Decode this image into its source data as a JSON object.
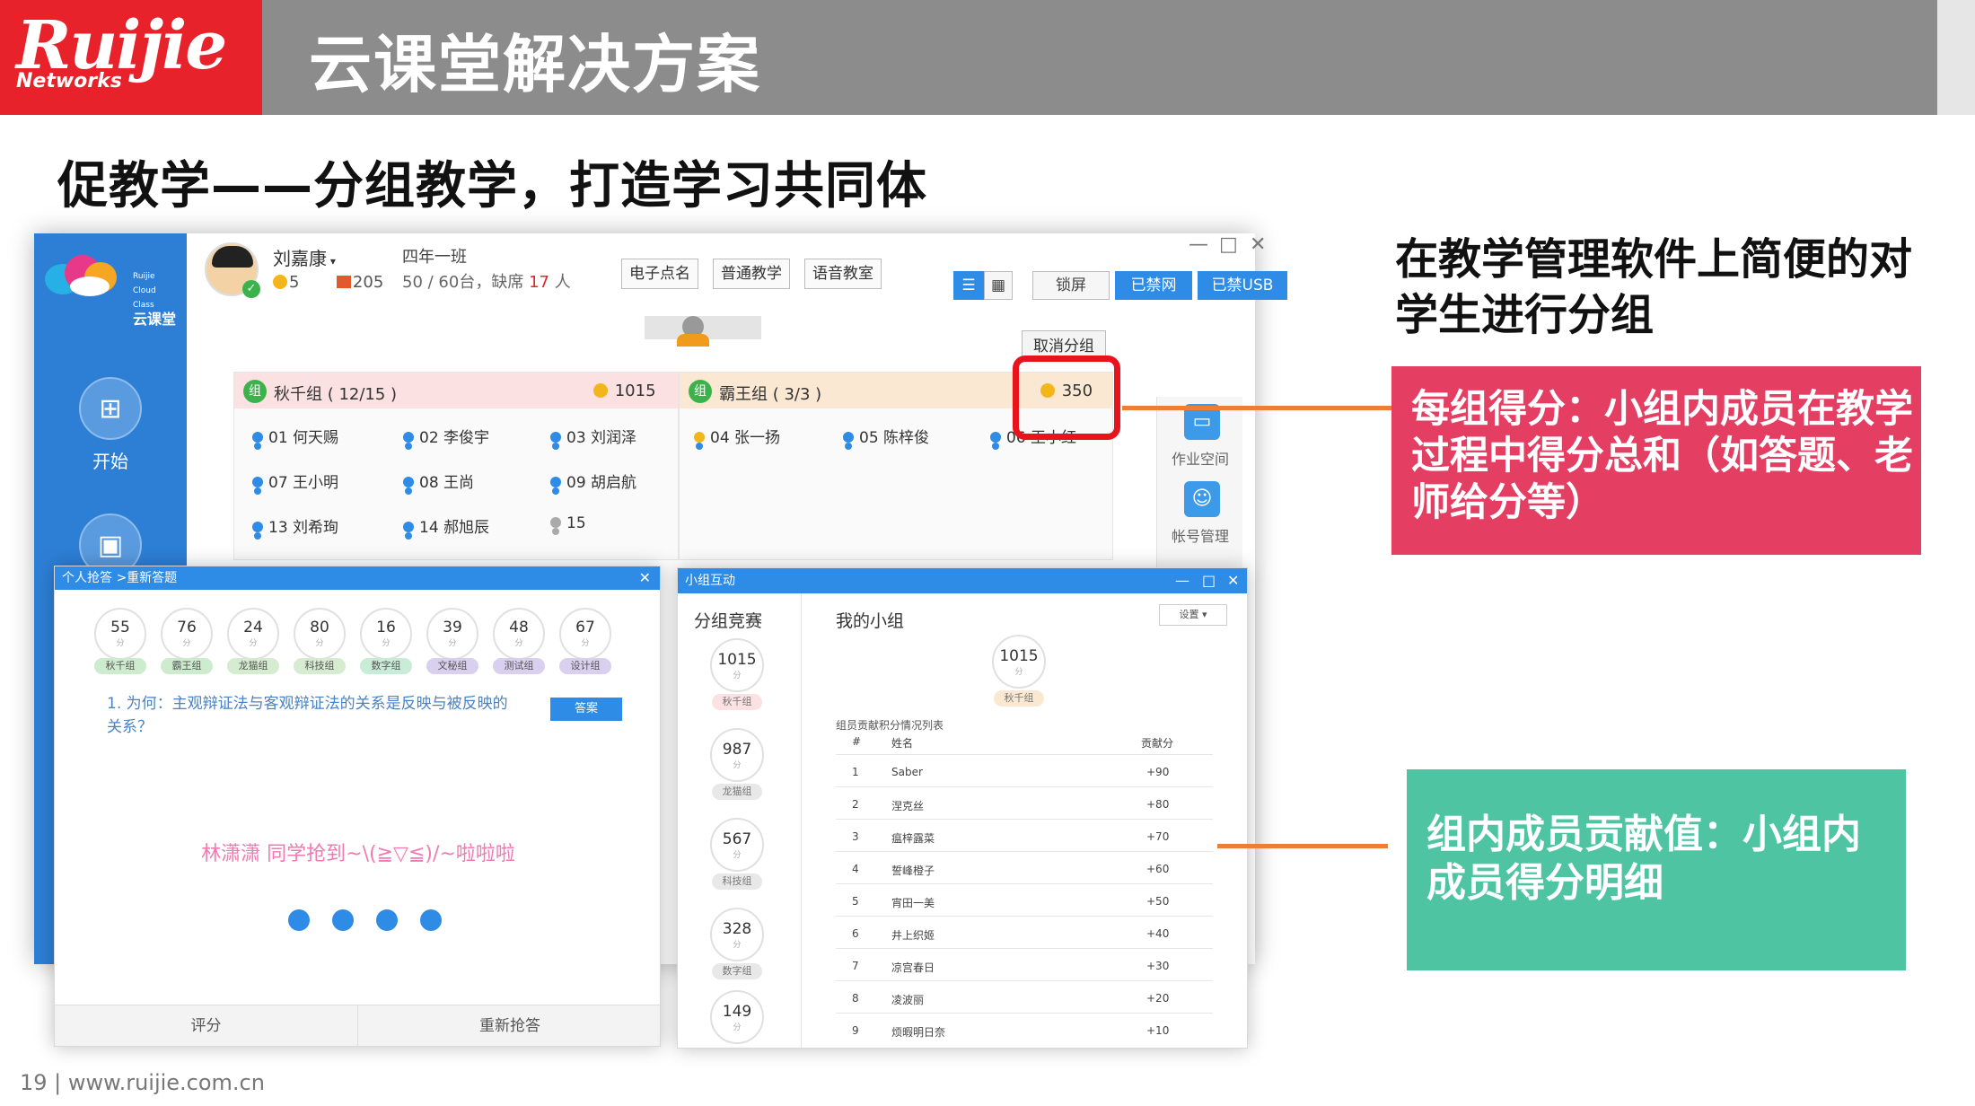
{
  "header": {
    "logo_main": "Ruijie",
    "logo_sub": "Networks",
    "title": "云课堂解决方案"
  },
  "subtitle": "促教学——分组教学，打造学习共同体",
  "app": {
    "sidebar": {
      "brand_line1": "Ruijie",
      "brand_line2": "Cloud Class",
      "brand_line3": "云课堂",
      "items": [
        {
          "label": "开始",
          "icon": "windows-icon"
        },
        {
          "label": "",
          "icon": "monitor-icon"
        }
      ]
    },
    "user": {
      "name": "刘嘉康",
      "coins": "5",
      "gifts": "205"
    },
    "class": {
      "name": "四年一班",
      "stats_prefix": "50 / 60台，缺席",
      "absent": "17",
      "absent_unit": "人"
    },
    "toolbar": {
      "roll_call": "电子点名",
      "normal_teaching": "普通教学",
      "voice_classroom": "语音教室",
      "lock_screen": "锁屏",
      "net_disabled": "已禁网",
      "usb_disabled": "已禁USB",
      "cancel_group": "取消分组"
    },
    "groups": [
      {
        "badge": "组",
        "name": "秋千组 ( 12/15 )",
        "score": "1015",
        "students": [
          "01 何天赐",
          "02 李俊宇",
          "03 刘润泽",
          "07 王小明",
          "08 王尚",
          "09 胡启航",
          "13 刘希珣",
          "14 郝旭辰",
          "15"
        ]
      },
      {
        "badge": "组",
        "name": "霸王组 ( 3/3 )",
        "score": "350",
        "students": [
          "04 张一扬",
          "05 陈梓俊",
          "06 王小红"
        ]
      }
    ],
    "right_panel": [
      {
        "label": "作业空间",
        "icon": "folder-icon"
      },
      {
        "label": "帐号管理",
        "icon": "user-icon"
      }
    ]
  },
  "answer_dialog": {
    "title": "个人抢答 >重新答题",
    "unit": "分",
    "scores": [
      {
        "value": "55",
        "tag": "秋千组",
        "color": "#cdeccd"
      },
      {
        "value": "76",
        "tag": "霸王组",
        "color": "#cdeccd"
      },
      {
        "value": "24",
        "tag": "龙猫组",
        "color": "#d6ecd0"
      },
      {
        "value": "80",
        "tag": "科技组",
        "color": "#d6ecd0"
      },
      {
        "value": "16",
        "tag": "数字组",
        "color": "#c9ecd6"
      },
      {
        "value": "39",
        "tag": "文秘组",
        "color": "#d8d0ee"
      },
      {
        "value": "48",
        "tag": "测试组",
        "color": "#d8d0ee"
      },
      {
        "value": "67",
        "tag": "设计组",
        "color": "#d8d0ee"
      }
    ],
    "question": "1. 为何：主观辩证法与客观辩证法的关系是反映与被反映的关系？",
    "answer_button": "答案",
    "grab_text": "林潇潇 同学抢到~\\(≧▽≦)/~啦啦啦",
    "score_button": "评分",
    "retry_button": "重新抢答"
  },
  "group_dialog": {
    "title": "小组互动",
    "left_heading": "分组竞赛",
    "main_heading": "我的小组",
    "settings": "设置",
    "unit": "分",
    "ranking": [
      {
        "value": "1015",
        "tag": "秋千组"
      },
      {
        "value": "987",
        "tag": "龙猫组"
      },
      {
        "value": "567",
        "tag": "科技组"
      },
      {
        "value": "328",
        "tag": "数字组"
      },
      {
        "value": "149",
        "tag": ""
      }
    ],
    "my_group": {
      "value": "1015",
      "tag": "秋千组"
    },
    "contrib_title": "组员贡献积分情况列表",
    "columns": [
      "#",
      "姓名",
      "贡献分"
    ],
    "rows": [
      [
        "1",
        "Saber",
        "+90"
      ],
      [
        "2",
        "涅克丝",
        "+80"
      ],
      [
        "3",
        "瘟梓露菜",
        "+70"
      ],
      [
        "4",
        "誓峰橙子",
        "+60"
      ],
      [
        "5",
        "宵田一美",
        "+50"
      ],
      [
        "6",
        "井上织姬",
        "+40"
      ],
      [
        "7",
        "凉宫春日",
        "+30"
      ],
      [
        "8",
        "凌波丽",
        "+20"
      ],
      [
        "9",
        "烦暇明日奈",
        "+10"
      ]
    ]
  },
  "annotations": {
    "heading": "在教学管理软件上简便的对学生进行分组",
    "group_score": "每组得分：小组内成员在教学过程中得分总和（如答题、老师给分等）",
    "member_contrib": "组内成员贡献值：小组内成员得分明细"
  },
  "footer": "19 | www.ruijie.com.cn"
}
